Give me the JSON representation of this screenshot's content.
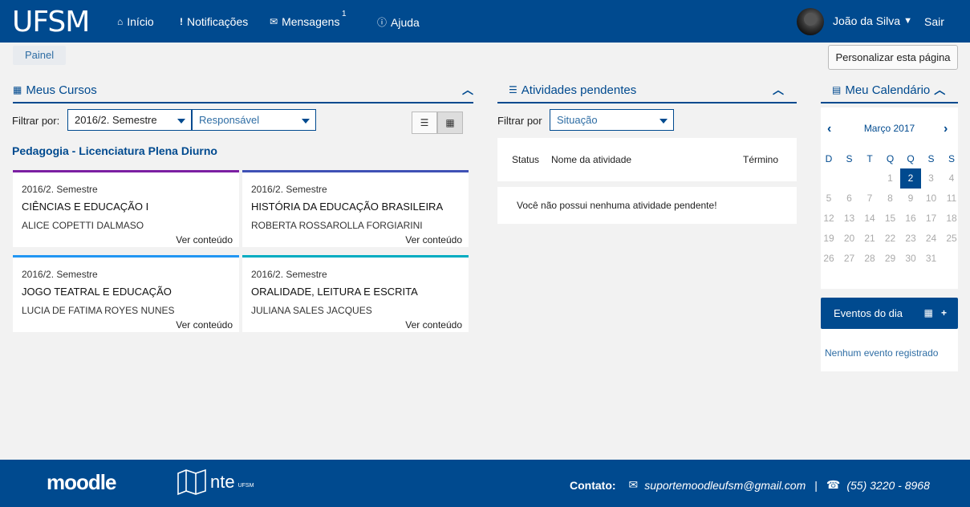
{
  "header": {
    "logo": "UFSM",
    "nav": [
      {
        "icon": "home-icon",
        "label": "Início"
      },
      {
        "icon": "exclamation-icon",
        "label": "Notificações"
      },
      {
        "icon": "envelope-icon",
        "label": "Mensagens"
      },
      {
        "icon": "question-circle-icon",
        "label": "Ajuda"
      }
    ],
    "messages_badge": "1",
    "user_name": "João da Silva",
    "logout": "Sair"
  },
  "breadcrumb": "Painel",
  "customize_button": "Personalizar esta página",
  "courses": {
    "title": "Meus Cursos",
    "filter_label": "Filtrar por:",
    "filter_semester": "2016/2. Semestre",
    "filter_role": "Responsável",
    "program": "Pedagogia - Licenciatura Plena Diurno",
    "cards": [
      {
        "semester": "2016/2. Semestre",
        "name": "CIÊNCIAS E EDUCAÇÃO I",
        "teacher": "ALICE COPETTI DALMASO",
        "link": "Ver conteúdo",
        "color": "#7b1fa2"
      },
      {
        "semester": "2016/2. Semestre",
        "name": "HISTÓRIA DA EDUCAÇÃO BRASILEIRA",
        "teacher": "ROBERTA ROSSAROLLA FORGIARINI",
        "link": "Ver conteúdo",
        "color": "#3f51b5"
      },
      {
        "semester": "2016/2. Semestre",
        "name": "JOGO TEATRAL E EDUCAÇÃO",
        "teacher": "LUCIA DE FATIMA ROYES NUNES",
        "link": "Ver conteúdo",
        "color": "#2196f3"
      },
      {
        "semester": "2016/2. Semestre",
        "name": "ORALIDADE, LEITURA E ESCRITA",
        "teacher": "JULIANA SALES JACQUES",
        "link": "Ver conteúdo",
        "color": "#00acc1"
      }
    ]
  },
  "activities": {
    "title": "Atividades pendentes",
    "filter_label": "Filtrar por",
    "filter_value": "Situação",
    "col_status": "Status",
    "col_name": "Nome da atividade",
    "col_end": "Término",
    "empty": "Você não possui nenhuma atividade pendente!"
  },
  "calendar": {
    "title": "Meu Calendário",
    "month": "Março 2017",
    "weekdays": [
      "D",
      "S",
      "T",
      "Q",
      "Q",
      "S",
      "S"
    ],
    "today": "2",
    "days": [
      "1",
      "2",
      "3",
      "4",
      "5",
      "6",
      "7",
      "8",
      "9",
      "10",
      "11",
      "12",
      "13",
      "14",
      "15",
      "16",
      "17",
      "18",
      "19",
      "20",
      "21",
      "22",
      "23",
      "24",
      "25",
      "26",
      "27",
      "28",
      "29",
      "30",
      "31"
    ]
  },
  "events": {
    "title": "Eventos do dia",
    "empty": "Nenhum evento registrado"
  },
  "footer": {
    "moodle": "moodle",
    "nte": "nte",
    "nte_sub": "UFSM",
    "contact_label": "Contato:",
    "email": "suportemoodleufsm@gmail.com",
    "phone": "(55) 3220 - 8968"
  }
}
